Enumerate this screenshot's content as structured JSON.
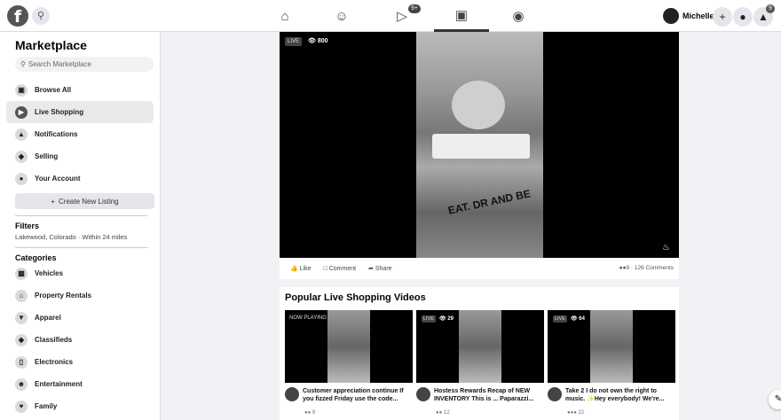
{
  "topbar": {
    "logo": "f",
    "profile_name": "Michelle",
    "watch_badge": "9+",
    "notif_badge": "9",
    "icons": [
      "home-icon",
      "friends-icon",
      "watch-icon",
      "marketplace-icon",
      "groups-icon"
    ]
  },
  "sidebar": {
    "title": "Marketplace",
    "search_placeholder": "Search Marketplace",
    "nav": [
      {
        "label": "Browse All",
        "icon": "storefront-icon"
      },
      {
        "label": "Live Shopping",
        "icon": "video-icon"
      },
      {
        "label": "Notifications",
        "icon": "bell-icon"
      },
      {
        "label": "Selling",
        "icon": "tag-icon"
      },
      {
        "label": "Your Account",
        "icon": "person-icon"
      }
    ],
    "create_listing": "Create New Listing",
    "filters_heading": "Filters",
    "filters_value": "Lakewood, Colorado · Within 24 miles",
    "categories_heading": "Categories",
    "categories": [
      {
        "label": "Vehicles",
        "icon": "car-icon"
      },
      {
        "label": "Property Rentals",
        "icon": "house-icon"
      },
      {
        "label": "Apparel",
        "icon": "shirt-icon"
      },
      {
        "label": "Classifieds",
        "icon": "tag-icon"
      },
      {
        "label": "Electronics",
        "icon": "phone-icon"
      },
      {
        "label": "Entertainment",
        "icon": "people-icon"
      },
      {
        "label": "Family",
        "icon": "heart-icon"
      }
    ]
  },
  "video": {
    "live_label": "LIVE",
    "viewers": "800",
    "overlay_text": "EAT. DR\nAND BE"
  },
  "actions": {
    "like": "Like",
    "comment": "Comment",
    "share": "Share",
    "reactions": "9 · 126 Comments"
  },
  "popular": {
    "title": "Popular Live Shopping Videos",
    "cards": [
      {
        "tag": "NOW PLAYING",
        "viewers": "",
        "text": "Customer appreciation continue If you fizzed Friday use the code...",
        "reactions": "9"
      },
      {
        "tag": "LIVE",
        "viewers": "29",
        "text": "Hostess Rewards Recap of NEW INVENTORY This is ... Paparazzi...",
        "reactions": "12"
      },
      {
        "tag": "LIVE",
        "viewers": "64",
        "text": "Take 2 I do not own the right to music. ✨Hey everybody! We're...",
        "reactions": "22"
      }
    ]
  }
}
